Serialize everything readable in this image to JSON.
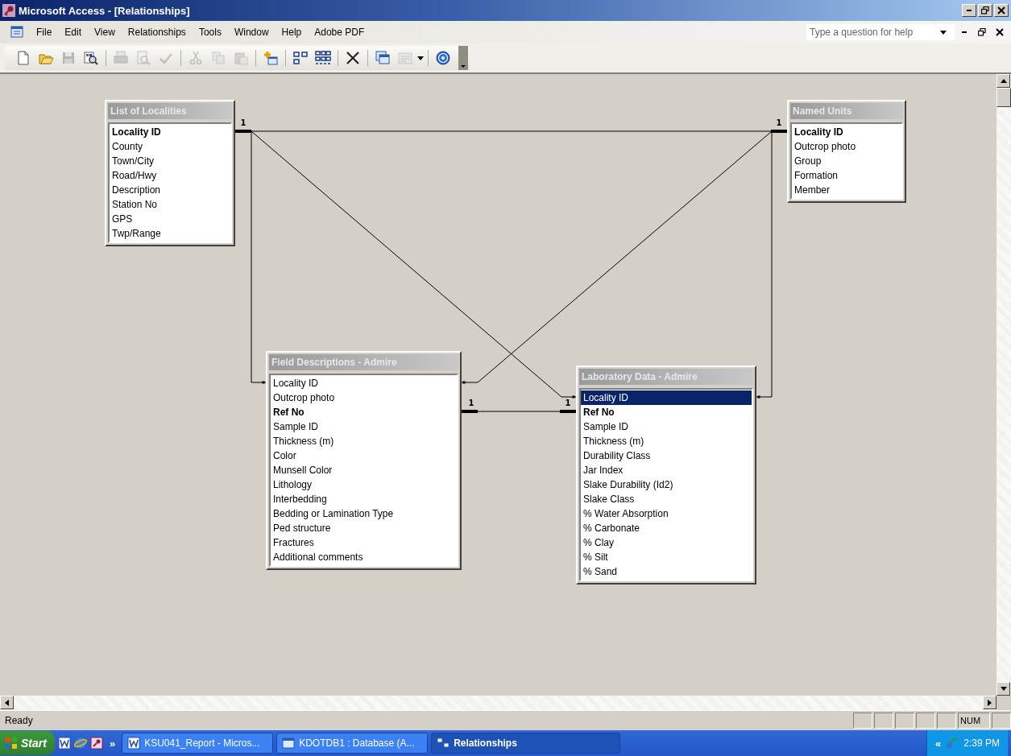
{
  "window": {
    "title": "Microsoft Access - [Relationships]"
  },
  "menu": [
    {
      "label": "File"
    },
    {
      "label": "Edit"
    },
    {
      "label": "View"
    },
    {
      "label": "Relationships"
    },
    {
      "label": "Tools"
    },
    {
      "label": "Window"
    },
    {
      "label": "Help"
    },
    {
      "label": "Adobe PDF"
    }
  ],
  "help_box": {
    "placeholder": "Type a question for help"
  },
  "toolbar": [
    {
      "buttons": [
        {
          "kind": "new",
          "disabled": false
        },
        {
          "kind": "open",
          "disabled": false
        },
        {
          "kind": "save",
          "disabled": true
        },
        {
          "kind": "properties",
          "disabled": false
        }
      ]
    },
    {
      "buttons": [
        {
          "kind": "print",
          "disabled": true
        },
        {
          "kind": "preview",
          "disabled": true
        },
        {
          "kind": "spelling",
          "disabled": true
        }
      ]
    },
    {
      "buttons": [
        {
          "kind": "cut",
          "disabled": true
        },
        {
          "kind": "copy",
          "disabled": true
        },
        {
          "kind": "paste",
          "disabled": true
        }
      ]
    },
    {
      "buttons": [
        {
          "kind": "showtable",
          "disabled": false
        }
      ]
    },
    {
      "buttons": [
        {
          "kind": "direct",
          "disabled": false
        },
        {
          "kind": "all",
          "disabled": false
        }
      ]
    },
    {
      "buttons": [
        {
          "kind": "delete",
          "disabled": false
        }
      ]
    },
    {
      "buttons": [
        {
          "kind": "dbwindow",
          "disabled": false
        },
        {
          "kind": "newobject",
          "disabled": true
        }
      ]
    },
    {
      "buttons": [
        {
          "kind": "help",
          "disabled": false
        }
      ]
    }
  ],
  "tables": [
    {
      "title": "List of Localities",
      "fields": [
        {
          "name": "Locality ID",
          "key": true,
          "selected": false
        },
        {
          "name": "County",
          "key": false,
          "selected": false
        },
        {
          "name": "Town/City",
          "key": false,
          "selected": false
        },
        {
          "name": "Road/Hwy",
          "key": false,
          "selected": false
        },
        {
          "name": "Description",
          "key": false,
          "selected": false
        },
        {
          "name": "Station No",
          "key": false,
          "selected": false
        },
        {
          "name": "GPS",
          "key": false,
          "selected": false
        },
        {
          "name": "Twp/Range",
          "key": false,
          "selected": false
        }
      ]
    },
    {
      "title": "Named Units",
      "fields": [
        {
          "name": "Locality ID",
          "key": true,
          "selected": false
        },
        {
          "name": "Outcrop photo",
          "key": false,
          "selected": false
        },
        {
          "name": "Group",
          "key": false,
          "selected": false
        },
        {
          "name": "Formation",
          "key": false,
          "selected": false
        },
        {
          "name": "Member",
          "key": false,
          "selected": false
        }
      ]
    },
    {
      "title": "Field Descriptions - Admire",
      "fields": [
        {
          "name": "Locality ID",
          "key": false,
          "selected": false
        },
        {
          "name": "Outcrop photo",
          "key": false,
          "selected": false
        },
        {
          "name": "Ref No",
          "key": true,
          "selected": false
        },
        {
          "name": "Sample ID",
          "key": false,
          "selected": false
        },
        {
          "name": "Thickness (m)",
          "key": false,
          "selected": false
        },
        {
          "name": "Color",
          "key": false,
          "selected": false
        },
        {
          "name": "Munsell Color",
          "key": false,
          "selected": false
        },
        {
          "name": "Lithology",
          "key": false,
          "selected": false
        },
        {
          "name": "Interbedding",
          "key": false,
          "selected": false
        },
        {
          "name": "Bedding or Lamination Type",
          "key": false,
          "selected": false
        },
        {
          "name": "Ped structure",
          "key": false,
          "selected": false
        },
        {
          "name": "Fractures",
          "key": false,
          "selected": false
        },
        {
          "name": "Additional comments",
          "key": false,
          "selected": false
        }
      ]
    },
    {
      "title": "Laboratory Data - Admire",
      "fields": [
        {
          "name": "Locality ID",
          "key": false,
          "selected": true
        },
        {
          "name": "Ref No",
          "key": true,
          "selected": false
        },
        {
          "name": "Sample ID",
          "key": false,
          "selected": false
        },
        {
          "name": "Thickness (m)",
          "key": false,
          "selected": false
        },
        {
          "name": "Durability Class",
          "key": false,
          "selected": false
        },
        {
          "name": "Jar Index",
          "key": false,
          "selected": false
        },
        {
          "name": "Slake Durability (Id2)",
          "key": false,
          "selected": false
        },
        {
          "name": "Slake Class",
          "key": false,
          "selected": false
        },
        {
          "name": "% Water Absorption",
          "key": false,
          "selected": false
        },
        {
          "name": "% Carbonate",
          "key": false,
          "selected": false
        },
        {
          "name": "% Clay",
          "key": false,
          "selected": false
        },
        {
          "name": "% Silt",
          "key": false,
          "selected": false
        },
        {
          "name": "% Sand",
          "key": false,
          "selected": false
        }
      ]
    }
  ],
  "relationships": [
    {
      "enforced": true,
      "labels": [
        "1",
        "1"
      ]
    },
    {
      "enforced": false
    },
    {
      "enforced": false
    },
    {
      "enforced": false
    },
    {
      "enforced": false
    },
    {
      "enforced": true,
      "labels": [
        "1",
        "1"
      ]
    }
  ],
  "status_bar": {
    "text": "Ready",
    "indicator": "NUM"
  },
  "taskbar": {
    "start": "Start",
    "more": "»",
    "tasks": [
      {
        "label": "KSU041_Report - Micros...",
        "kind": "word",
        "selected": false
      },
      {
        "label": "KDOTDB1 : Database (A...",
        "kind": "database",
        "selected": false
      },
      {
        "label": "Relationships",
        "kind": "relationships",
        "selected": true
      }
    ],
    "tray_toggle": "«",
    "clock": "2:39 PM"
  }
}
